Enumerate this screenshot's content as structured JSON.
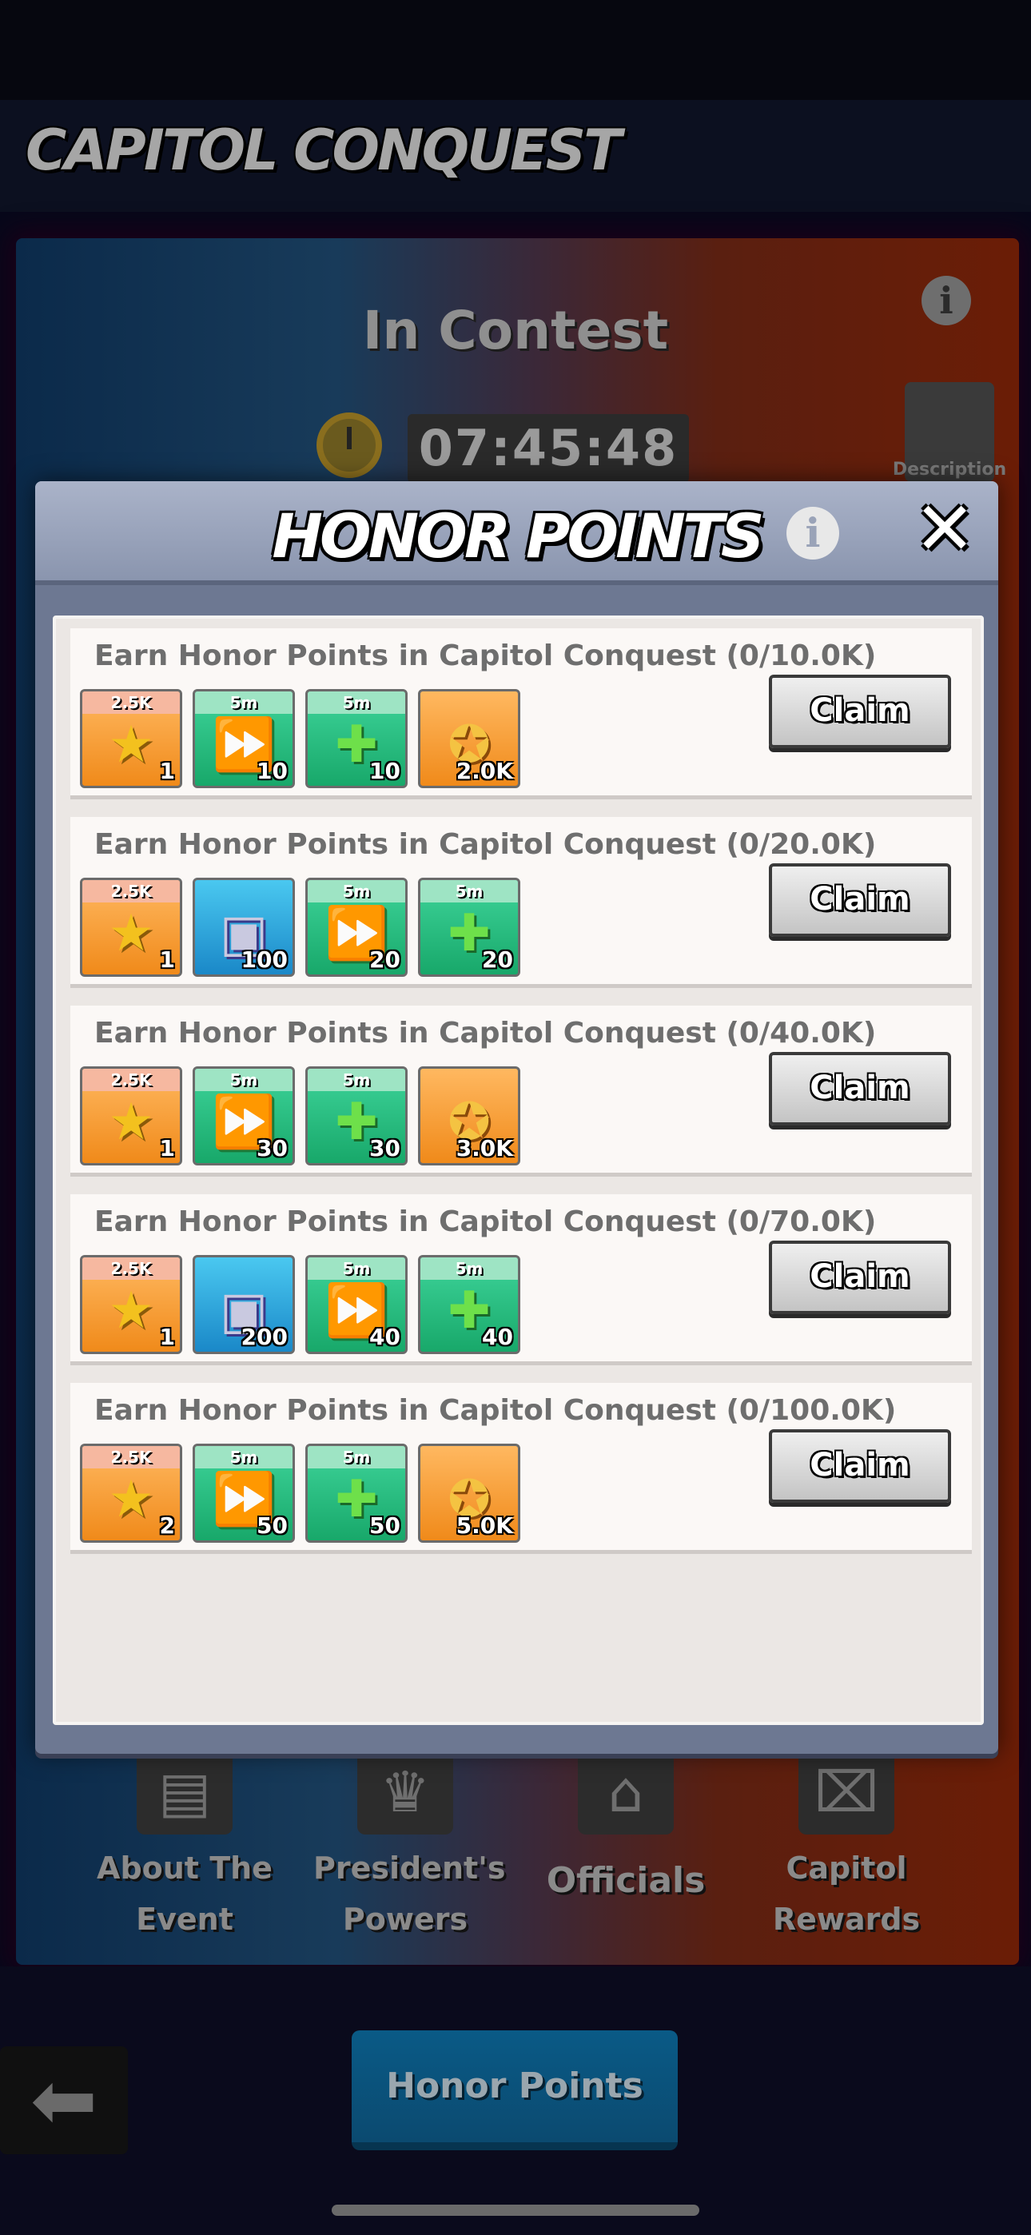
{
  "header": {
    "title": "CAPITOL CONQUEST"
  },
  "contest": {
    "status": "In Contest",
    "timer": "07:45:48",
    "info_icon": "info-icon",
    "description_label": "Description"
  },
  "modal": {
    "title": "HONOR POINTS",
    "info_icon": "info-icon",
    "close_icon": "close-icon",
    "claim_label": "Claim",
    "tasks": [
      {
        "title": "Earn  Honor Points in Capitol Conquest (0/10.0K)",
        "items": [
          {
            "kind": "badge",
            "color": "orange",
            "top": "2.5K",
            "qty": "1"
          },
          {
            "kind": "speedup",
            "color": "green",
            "top": "5m",
            "qty": "10"
          },
          {
            "kind": "heal",
            "color": "green",
            "top": "5m",
            "qty": "10"
          },
          {
            "kind": "medal",
            "color": "orange",
            "top": "",
            "qty": "2.0K"
          }
        ]
      },
      {
        "title": "Earn  Honor Points in Capitol Conquest (0/20.0K)",
        "items": [
          {
            "kind": "badge",
            "color": "orange",
            "top": "2.5K",
            "qty": "1"
          },
          {
            "kind": "chest",
            "color": "blue",
            "top": "",
            "qty": "100"
          },
          {
            "kind": "speedup",
            "color": "green",
            "top": "5m",
            "qty": "20"
          },
          {
            "kind": "heal",
            "color": "green",
            "top": "5m",
            "qty": "20"
          }
        ]
      },
      {
        "title": "Earn  Honor Points in Capitol Conquest (0/40.0K)",
        "items": [
          {
            "kind": "badge",
            "color": "orange",
            "top": "2.5K",
            "qty": "1"
          },
          {
            "kind": "speedup",
            "color": "green",
            "top": "5m",
            "qty": "30"
          },
          {
            "kind": "heal",
            "color": "green",
            "top": "5m",
            "qty": "30"
          },
          {
            "kind": "medal",
            "color": "orange",
            "top": "",
            "qty": "3.0K"
          }
        ]
      },
      {
        "title": "Earn  Honor Points in Capitol Conquest (0/70.0K)",
        "items": [
          {
            "kind": "badge",
            "color": "orange",
            "top": "2.5K",
            "qty": "1"
          },
          {
            "kind": "chest",
            "color": "blue",
            "top": "",
            "qty": "200"
          },
          {
            "kind": "speedup",
            "color": "green",
            "top": "5m",
            "qty": "40"
          },
          {
            "kind": "heal",
            "color": "green",
            "top": "5m",
            "qty": "40"
          }
        ]
      },
      {
        "title": "Earn  Honor Points in Capitol Conquest (0/100.0K)",
        "items": [
          {
            "kind": "badge",
            "color": "orange",
            "top": "2.5K",
            "qty": "2"
          },
          {
            "kind": "speedup",
            "color": "green",
            "top": "5m",
            "qty": "50"
          },
          {
            "kind": "heal",
            "color": "green",
            "top": "5m",
            "qty": "50"
          },
          {
            "kind": "medal",
            "color": "orange",
            "top": "",
            "qty": "5.0K"
          }
        ]
      }
    ]
  },
  "bottom_nav": [
    {
      "label": "About The\nEvent",
      "icon": "document-icon"
    },
    {
      "label": "President's\nPowers",
      "icon": "crown-icon"
    },
    {
      "label": "Officials",
      "icon": "building-icon"
    },
    {
      "label": "Capitol\nRewards",
      "icon": "gift-icon"
    }
  ],
  "footer": {
    "honor_points_button": "Honor Points",
    "back_icon": "back-arrow-icon"
  },
  "colors": {
    "modal_frame": "#6d7892",
    "claim_bg": "#c4c4c4",
    "card_bg": "#fbf8f6",
    "item_orange": "#f08a1a",
    "item_green": "#18a86a",
    "item_blue": "#1a88c8"
  }
}
